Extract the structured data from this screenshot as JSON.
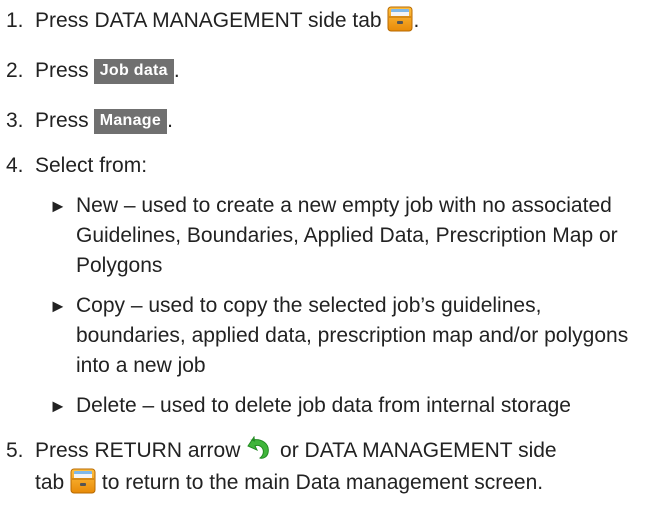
{
  "steps": [
    {
      "num": "1.",
      "pre": "Press DATA MANAGEMENT side tab",
      "post": "."
    },
    {
      "num": "2.",
      "pre": "Press",
      "button": "Job data",
      "post": "."
    },
    {
      "num": "3.",
      "pre": "Press",
      "button": "Manage",
      "post": "."
    },
    {
      "num": "4.",
      "text": "Select from:"
    },
    {
      "num": "5.",
      "pre": "Press RETURN arrow",
      "mid": "or DATA MANAGEMENT side",
      "line2_pre": "tab",
      "line2_post": "to return to the main Data management screen."
    }
  ],
  "options": [
    {
      "arrow": "►",
      "lines": [
        "New – used to create a new empty job with no associated",
        "Guidelines, Boundaries, Applied Data, Prescription Map or",
        "Polygons"
      ]
    },
    {
      "arrow": "►",
      "lines": [
        "Copy – used to copy the selected job’s guidelines,",
        "boundaries, applied data, prescription map and/or polygons",
        "into a new job"
      ]
    },
    {
      "arrow": "►",
      "lines": [
        "Delete – used to delete job data from internal storage"
      ]
    }
  ],
  "icons": {
    "data_management_tab": "data-management-cabinet-icon",
    "return_arrow": "return-arrow-icon"
  },
  "colors": {
    "text": "#222222",
    "button_bg": "#707070",
    "button_text": "#ffffff",
    "cabinet_orange": "#f2a014",
    "arrow_green": "#3fb53a"
  }
}
